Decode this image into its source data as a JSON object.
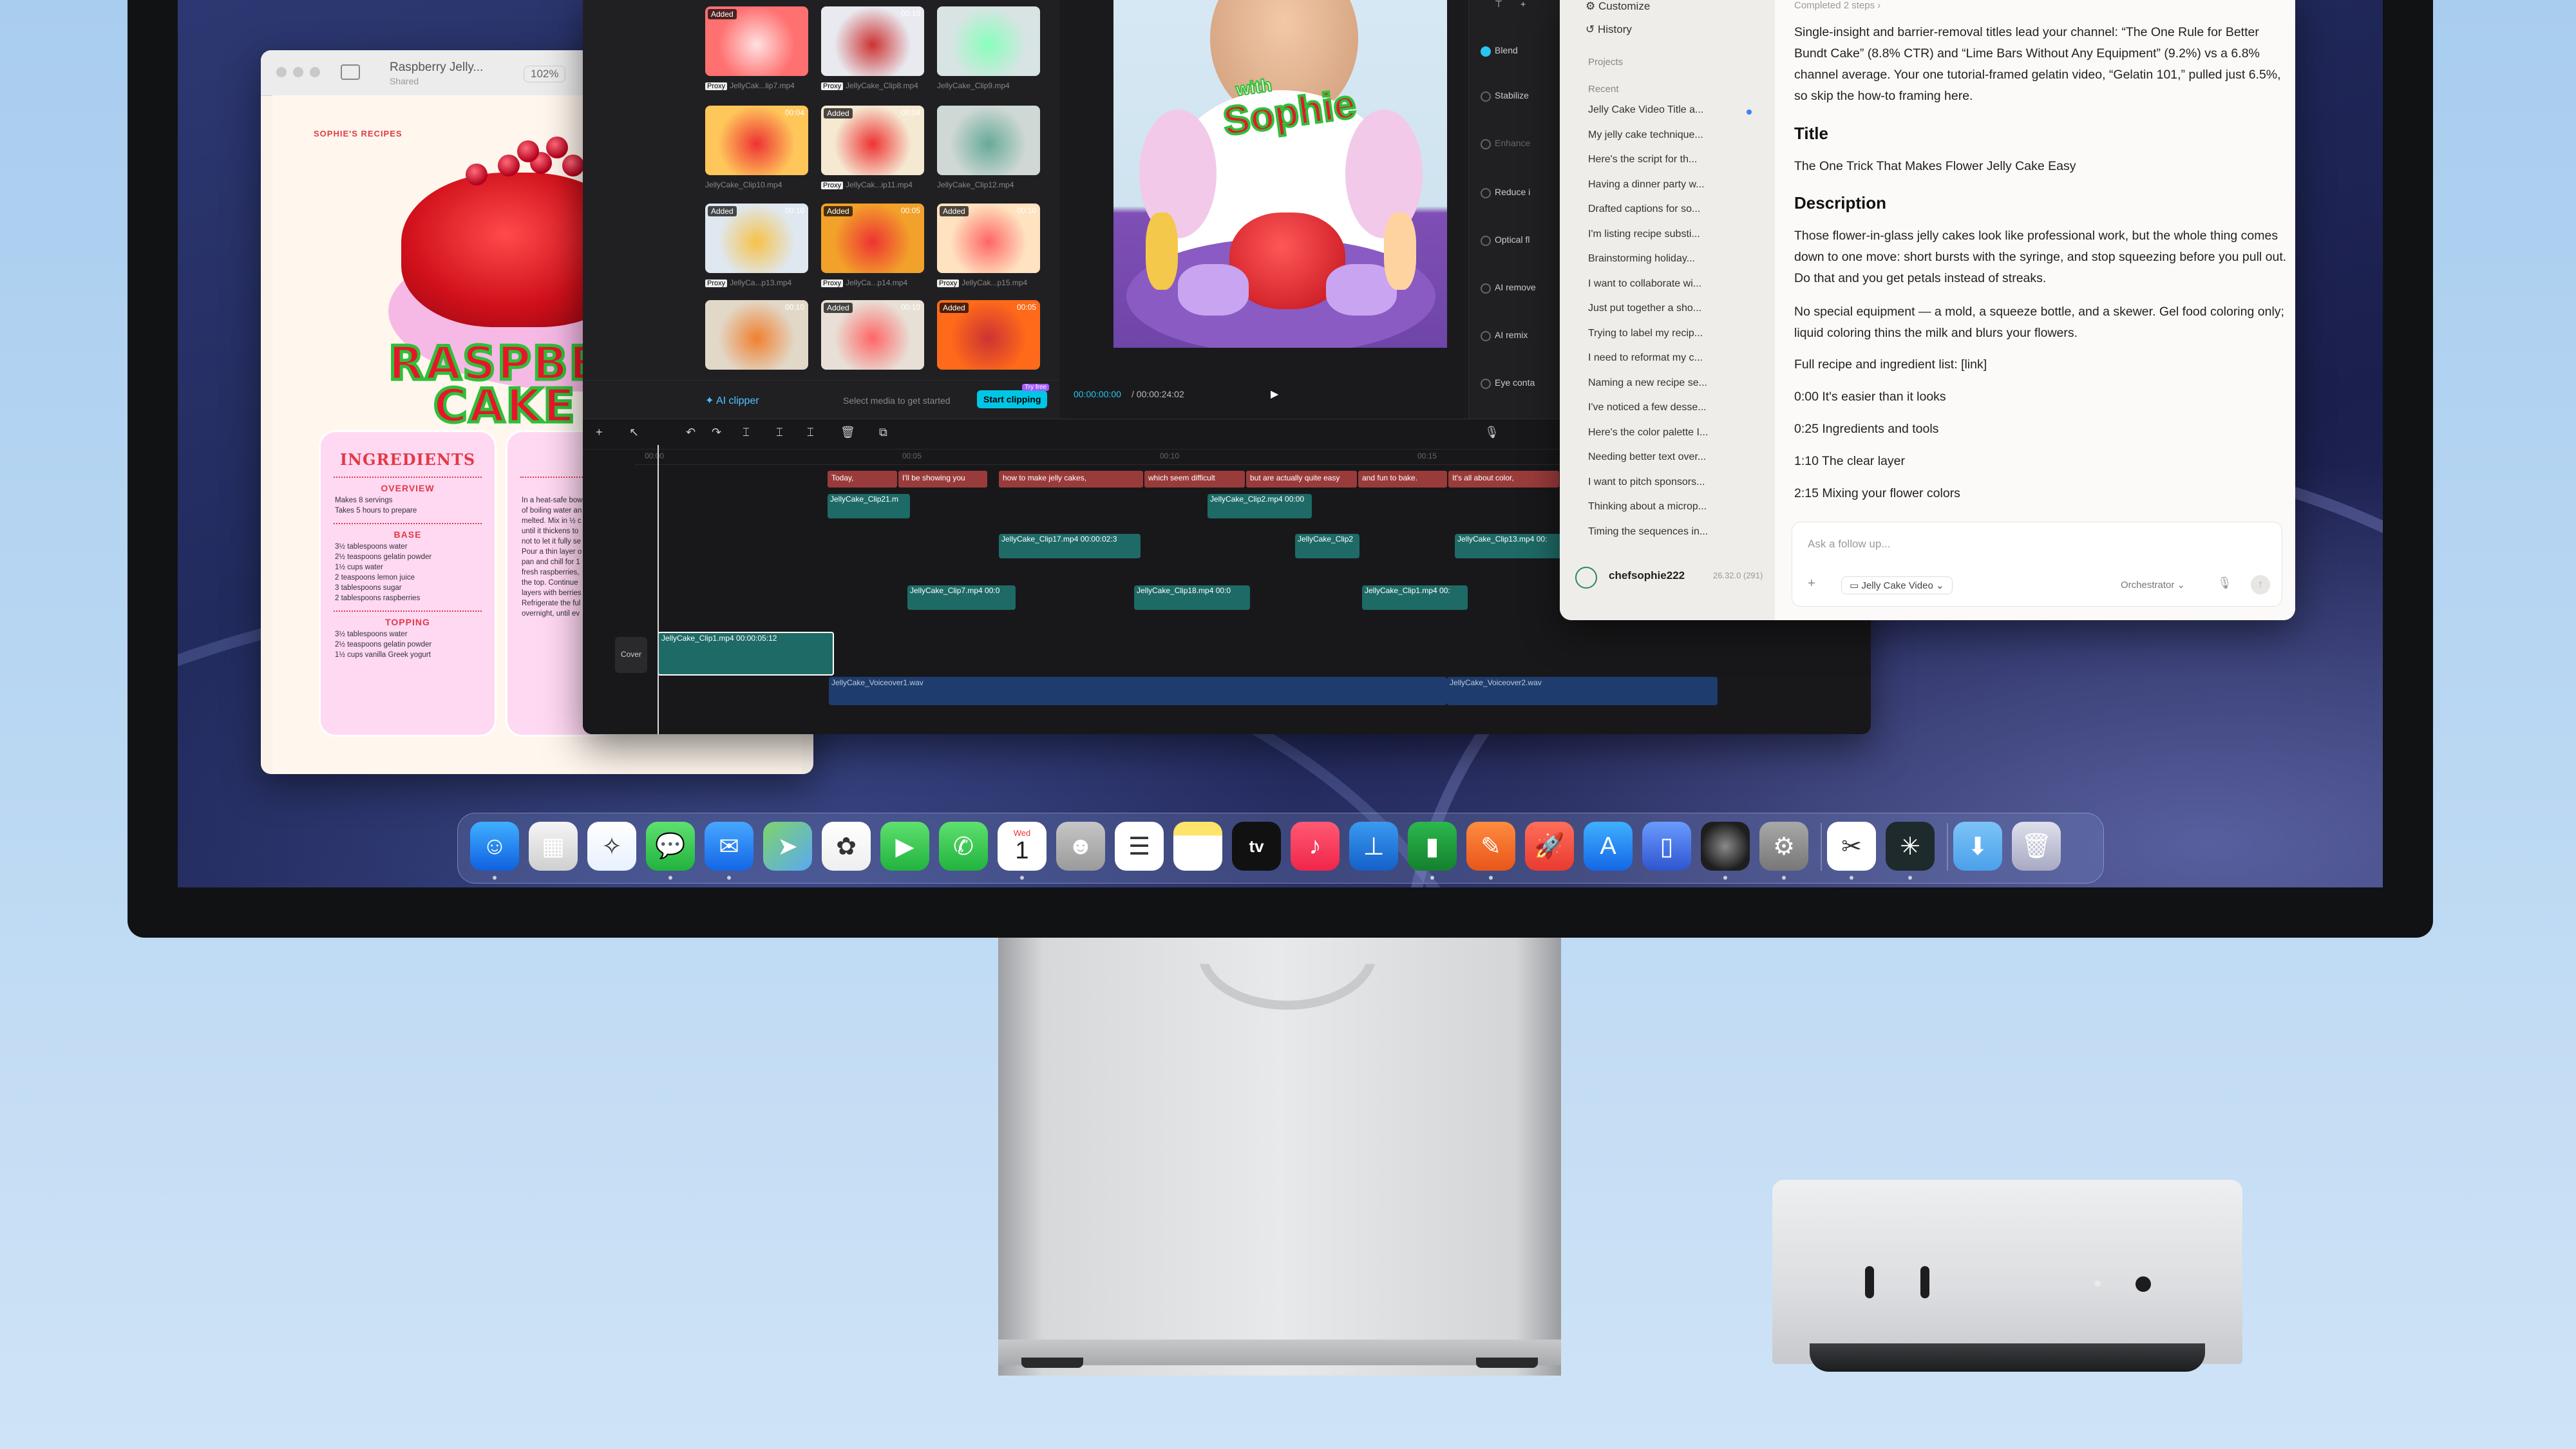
{
  "preview": {
    "title": "Raspberry Jelly...",
    "subtitle": "Shared",
    "zoom": "102%",
    "brand": "SOPHIE'S RECIPES",
    "headline_1": "RASPBERRY",
    "headline_2": "CAKE REC",
    "ingredients_title": "INGREDIENTS",
    "overview_label": "OVERVIEW",
    "overview_lines": [
      "Makes 8 servings",
      "Takes 5 hours to prepare"
    ],
    "base_label": "BASE",
    "base_lines": [
      "3½ tablespoons water",
      "2½ teaspoons gelatin powder",
      "1½ cups water",
      "2 teaspoons lemon juice",
      "3 tablespoons sugar",
      "2 tablespoons raspberries"
    ],
    "topping_label": "TOPPING",
    "topping_lines": [
      "3½ tablespoons water",
      "2½ teaspoons gelatin powder",
      "1½ cups vanilla Greek yogurt"
    ],
    "directions_title": "D",
    "directions_label": "P",
    "directions_lines": [
      "In a heat-safe bow",
      "of boiling water an",
      "melted. Mix in ½ c",
      "until it thickens to",
      "not to let it fully se",
      "",
      "Pour a thin layer o",
      "pan and chill for 1",
      "fresh raspberries,",
      "the top. Continue",
      "layers with berries",
      "",
      "Refrigerate the ful",
      "overnight, until ev"
    ]
  },
  "editor": {
    "thumbs": [
      {
        "tag": "Added",
        "dur": "",
        "label": "JellyCak...lip7.mp4",
        "proxy": true
      },
      {
        "tag": "",
        "dur": "00:10",
        "label": "JellyCake_Clip8.mp4",
        "proxy": true
      },
      {
        "tag": "",
        "dur": "",
        "label": "JellyCake_Clip9.mp4",
        "proxy": false
      },
      {
        "tag": "",
        "dur": "00:04",
        "label": "JellyCake_Clip10.mp4",
        "proxy": false
      },
      {
        "tag": "Added",
        "dur": "00:04",
        "label": "JellyCak...ip11.mp4",
        "proxy": true
      },
      {
        "tag": "",
        "dur": "",
        "label": "JellyCake_Clip12.mp4",
        "proxy": false
      },
      {
        "tag": "Added",
        "dur": "00:10",
        "label": "JellyCa...p13.mp4",
        "proxy": true
      },
      {
        "tag": "Added",
        "dur": "00:05",
        "label": "JellyCa...p14.mp4",
        "proxy": true
      },
      {
        "tag": "Added",
        "dur": "00:10",
        "label": "JellyCak...p15.mp4",
        "proxy": true
      },
      {
        "tag": "",
        "dur": "00:10",
        "label": "",
        "proxy": false
      },
      {
        "tag": "Added",
        "dur": "00:10",
        "label": "",
        "proxy": false
      },
      {
        "tag": "Added",
        "dur": "00:05",
        "label": "",
        "proxy": false
      }
    ],
    "ai_clipper": "AI clipper",
    "ai_hint": "Select media to get started",
    "start_clipping": "Start clipping",
    "try_badge": "Try free",
    "time_current": "00:00:00:00",
    "time_total": "/ 00:00:24:02",
    "overlay_text_1": "with",
    "overlay_text_2": "Sophie",
    "props": [
      "Blend",
      "Stabilize",
      "Enhance",
      "Reduce i",
      "Optical fl",
      "AI remove",
      "AI remix",
      "Eye conta"
    ],
    "ruler": [
      "00:00",
      "00:05",
      "00:10",
      "00:15"
    ],
    "captions": [
      {
        "text": "Today,",
        "color": "#9a3b3b"
      },
      {
        "text": "I'll be showing you",
        "color": "#9a3b3b"
      },
      {
        "text": "how to make jelly cakes,",
        "color": "#9a3b3b"
      },
      {
        "text": "which seem difficult",
        "color": "#9a3b3b"
      },
      {
        "text": "but are actually quite easy",
        "color": "#9a3b3b"
      },
      {
        "text": "and fun to bake.",
        "color": "#9a3b3b"
      },
      {
        "text": "It's all about color,",
        "color": "#9a3b3b"
      }
    ],
    "clips_row1": [
      "JellyCake_Clip21.m",
      "JellyCake_Clip2.mp4  00:00"
    ],
    "clips_row2": [
      "JellyCake_Clip17.mp4  00:00:02:3",
      "JellyCake_Clip2",
      "JellyCake_Clip13.mp4  00:"
    ],
    "clips_row3": [
      "JellyCake_Clip7.mp4  00:0",
      "JellyCake_Clip18.mp4  00:0",
      "JellyCake_Clip1.mp4  00:"
    ],
    "main_clip": "JellyCake_Clip1.mp4  00:00:05:12",
    "cover_label": "Cover",
    "audio_1": "JellyCake_Voiceover1.wav",
    "audio_2": "JellyCake_Voiceover2.wav"
  },
  "assistant": {
    "customize": "Customize",
    "history": "History",
    "projects_label": "Projects",
    "recent_label": "Recent",
    "recent_items": [
      "Jelly Cake Video Title a...",
      "My jelly cake technique...",
      "Here's the script for th...",
      "Having a dinner party w...",
      "Drafted captions for so...",
      "I'm listing recipe substi...",
      "Brainstorming holiday...",
      "I want to collaborate wi...",
      "Just put together a sho...",
      "Trying to label my recip...",
      "I need to reformat my c...",
      "Naming a new recipe se...",
      "I've noticed a few desse...",
      "Here's the color palette I...",
      "Needing better text over...",
      "I want to pitch sponsors...",
      "Thinking about a microp...",
      "Timing the sequences in..."
    ],
    "completed": "Completed 2 steps",
    "intro": "Single-insight and barrier-removal titles lead your channel: “The One Rule for Better Bundt Cake” (8.8% CTR) and “Lime Bars Without Any Equipment” (9.2%) vs a 6.8% channel average. Your one tutorial-framed gelatin video, “Gelatin 101,” pulled just 6.5%, so skip the how-to framing here.",
    "title_heading": "Title",
    "title_text": "The One Trick That Makes Flower Jelly Cake Easy",
    "desc_heading": "Description",
    "desc_1": "Those flower-in-glass jelly cakes look like professional work, but the whole thing comes down to one move: short bursts with the syringe, and stop squeezing before you pull out. Do that and you get petals instead of streaks.",
    "desc_2": "No special equipment — a mold, a squeeze bottle, and a skewer. Gel food coloring only; liquid coloring thins the milk and blurs your flowers.",
    "desc_3": "Full recipe and ingredient list: [link]",
    "chapters": [
      "0:00 It's easier than it looks",
      "0:25 Ingredients and tools",
      "1:10 The clear layer",
      "2:15 Mixing your flower colors"
    ],
    "ask_placeholder": "Ask a follow up...",
    "project_chip": "Jelly Cake Video",
    "orchestrator": "Orchestrator",
    "username": "chefsophie222",
    "version": "26.32.0 (291)"
  },
  "dock": {
    "calendar_day": "Wed",
    "calendar_date": "1",
    "apps": [
      "Finder",
      "Launchpad",
      "Safari",
      "Messages",
      "Mail",
      "Maps",
      "Photos",
      "FaceTime",
      "Phone",
      "Calendar",
      "Contacts",
      "Reminders",
      "Notes",
      "TV",
      "Music",
      "Keynote",
      "Numbers",
      "Pages",
      "Launcher",
      "App Store",
      "Mirror",
      "Camera",
      "System Settings",
      "CapCut",
      "Perplexity",
      "Downloads",
      "Trash"
    ]
  }
}
